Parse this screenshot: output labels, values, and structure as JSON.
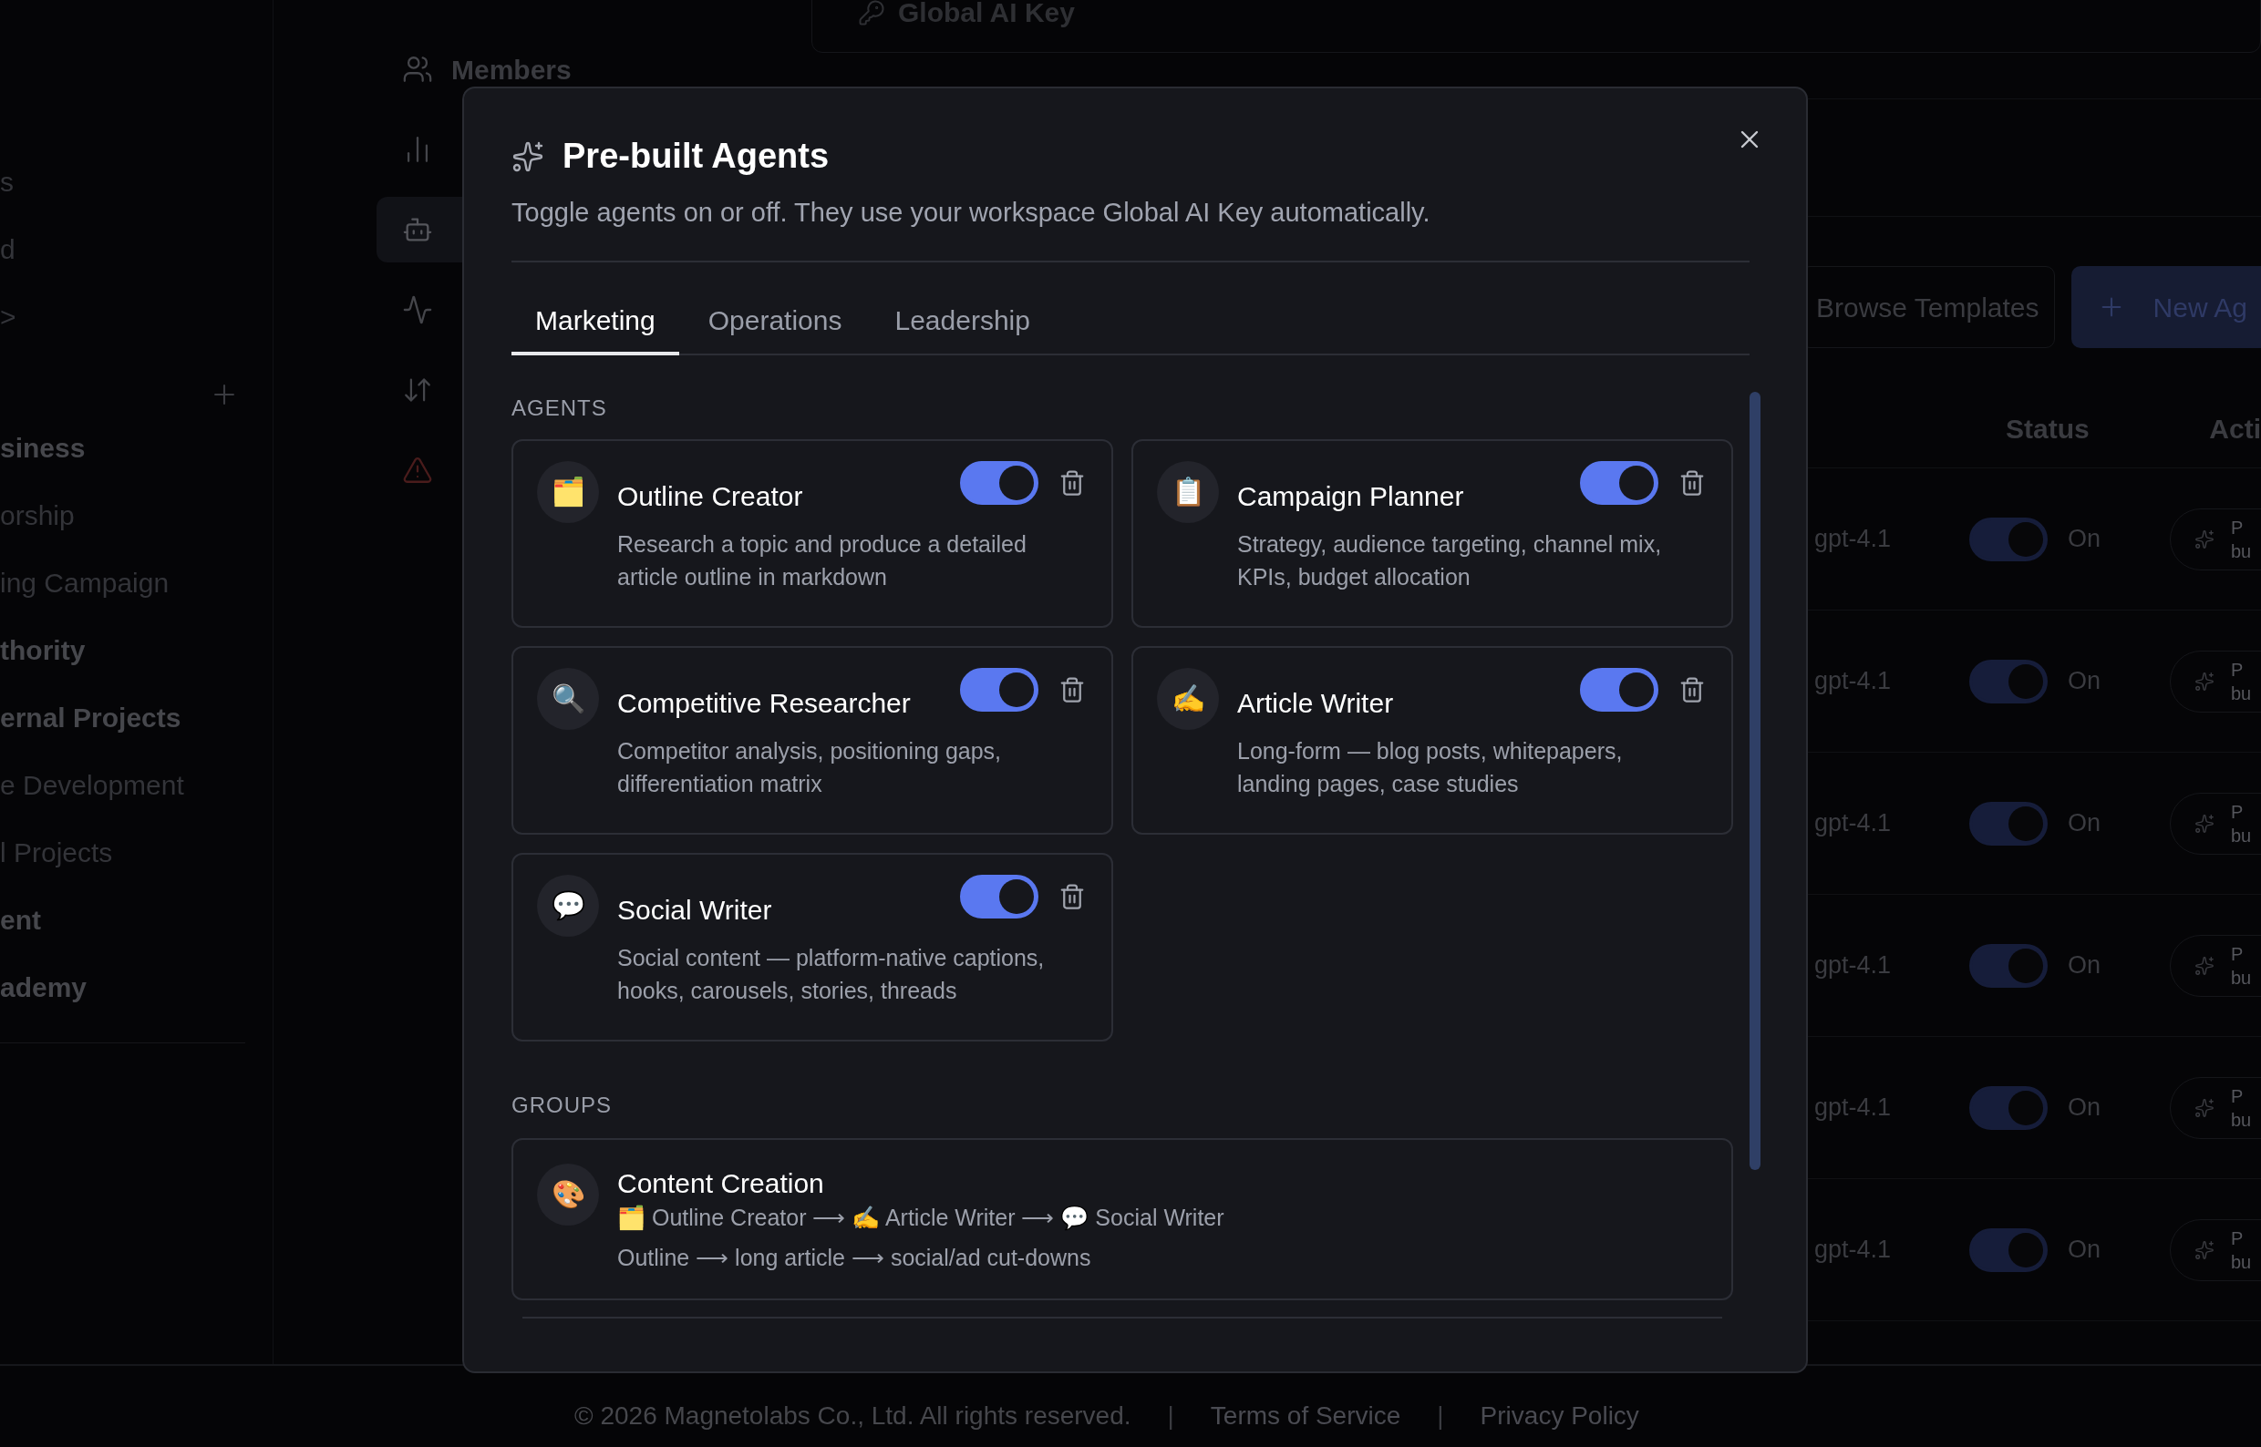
{
  "sidebar": {
    "items": [
      {
        "label": "s",
        "bold": false
      },
      {
        "label": "d",
        "bold": false
      },
      {
        "label": ">",
        "bold": false
      },
      {
        "label": "siness",
        "bold": true
      },
      {
        "label": "orship",
        "bold": false
      },
      {
        "label": "ing Campaign",
        "bold": false
      },
      {
        "label": "thority",
        "bold": true
      },
      {
        "label": "ernal Projects",
        "bold": true
      },
      {
        "label": "e Development",
        "bold": false
      },
      {
        "label": "l Projects",
        "bold": false
      },
      {
        "label": "ent",
        "bold": true
      },
      {
        "label": "ademy",
        "bold": true
      }
    ]
  },
  "nav": {
    "items": [
      {
        "label": "Members",
        "kind": "members",
        "selected": false
      },
      {
        "kind": "chart",
        "selected": false
      },
      {
        "kind": "bot",
        "selected": true
      },
      {
        "kind": "activity",
        "selected": false
      },
      {
        "kind": "transfer",
        "selected": false
      },
      {
        "kind": "danger",
        "selected": false
      }
    ]
  },
  "main": {
    "key_card": {
      "title": "Global AI Key"
    },
    "buttons": [
      {
        "label": "Browse Templates",
        "kind": "secondary"
      },
      {
        "label": "New Ag",
        "kind": "primary"
      }
    ],
    "table": {
      "columns": [
        "Status",
        "Acti"
      ],
      "rows": [
        {
          "model": "gpt-4.1",
          "status": "On",
          "on": true,
          "action": [
            "P",
            "bu"
          ]
        },
        {
          "model": "gpt-4.1",
          "status": "On",
          "on": true,
          "action": [
            "P",
            "bu"
          ]
        },
        {
          "model": "gpt-4.1",
          "status": "On",
          "on": true,
          "action": [
            "P",
            "bu"
          ]
        },
        {
          "model": "gpt-4.1",
          "status": "On",
          "on": true,
          "action": [
            "P",
            "bu"
          ]
        },
        {
          "model": "gpt-4.1",
          "status": "On",
          "on": true,
          "action": [
            "P",
            "bu"
          ]
        },
        {
          "model": "gpt-4.1",
          "status": "On",
          "on": true,
          "action": [
            "P",
            "bu"
          ]
        }
      ]
    }
  },
  "footer": {
    "items": [
      {
        "text": "© 2026 Magnetolabs Co., Ltd. All rights reserved.",
        "kind": "text"
      },
      {
        "text": "|",
        "kind": "separator"
      },
      {
        "text": "Terms of Service",
        "kind": "link"
      },
      {
        "text": "|",
        "kind": "separator"
      },
      {
        "text": "Privacy Policy",
        "kind": "link"
      }
    ]
  },
  "dialog": {
    "title": "Pre-built Agents",
    "subtitle": "Toggle agents on or off. They use your workspace Global AI Key automatically.",
    "tabs": [
      {
        "label": "Marketing",
        "selected": true
      },
      {
        "label": "Operations",
        "selected": false
      },
      {
        "label": "Leadership",
        "selected": false
      }
    ],
    "agents_heading": "AGENTS",
    "agents": [
      {
        "emoji": "🗂️",
        "name": "Outline Creator",
        "description": "Research a topic and produce a detailed article outline in markdown",
        "on": true
      },
      {
        "emoji": "📋",
        "name": "Campaign Planner",
        "description": "Strategy, audience targeting, channel mix, KPIs, budget allocation",
        "on": true
      },
      {
        "emoji": "🔍",
        "name": "Competitive Researcher",
        "description": "Competitor analysis, positioning gaps, differentiation matrix",
        "on": true
      },
      {
        "emoji": "✍️",
        "name": "Article Writer",
        "description": "Long-form — blog posts, whitepapers, landing pages, case studies",
        "on": true
      },
      {
        "emoji": "💬",
        "name": "Social Writer",
        "description": "Social content — platform-native captions, hooks, carousels, stories, threads",
        "on": true
      }
    ],
    "groups_heading": "GROUPS",
    "groups": [
      {
        "emoji": "🎨",
        "name": "Content Creation",
        "chain": "🗂️ Outline Creator ⟶ ✍️ Article Writer ⟶ 💬 Social Writer",
        "description": "Outline ⟶ long article ⟶ social/ad cut-downs"
      }
    ]
  }
}
